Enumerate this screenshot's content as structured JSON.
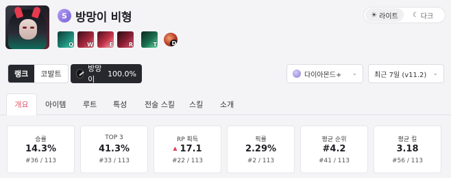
{
  "champion": {
    "name": "방망이 비형",
    "tier_badge": "S",
    "skills": [
      {
        "key": "Q",
        "icon": "skill-q-icon",
        "color": "#1f8c7a"
      },
      {
        "key": "W",
        "icon": "skill-w-icon",
        "color": "#a82840"
      },
      {
        "key": "E",
        "icon": "skill-e-icon",
        "color": "#c23246"
      },
      {
        "key": "R",
        "icon": "skill-r-icon",
        "color": "#8a1f34"
      },
      {
        "key": "T",
        "icon": "skill-t-icon",
        "color": "#1a6e4f"
      },
      {
        "key": "D",
        "icon": "skill-d-icon",
        "color": "#b83a24"
      }
    ]
  },
  "theme": {
    "light_label": "라이트",
    "dark_label": "다크",
    "light_icon": "sun-icon",
    "dark_icon": "moon-icon"
  },
  "modes": {
    "rank": "랭크",
    "cobalt": "코발트"
  },
  "selected_champion": {
    "name": "방망이",
    "rate": "100.0%"
  },
  "filters": {
    "tier": "다이아몬드+",
    "version": "최근 7일 (v11.2)"
  },
  "tabs": [
    "개요",
    "아이템",
    "루트",
    "특성",
    "전술 스킬",
    "스킬",
    "소개"
  ],
  "stats": [
    {
      "title": "승률",
      "value": "14.3%",
      "rank": "#36",
      "total": "113"
    },
    {
      "title": "TOP 3",
      "value": "41.3%",
      "rank": "#33",
      "total": "113"
    },
    {
      "title": "RP 획득",
      "value": "17.1",
      "rank": "#22",
      "total": "113",
      "trend": "up"
    },
    {
      "title": "픽률",
      "value": "2.29%",
      "rank": "#2",
      "total": "113"
    },
    {
      "title": "평균 순위",
      "value": "#4.2",
      "rank": "#41",
      "total": "113"
    },
    {
      "title": "평균 킬",
      "value": "3.18",
      "rank": "#56",
      "total": "113"
    }
  ],
  "colors": {
    "accent": "#e0556b",
    "dark": "#27272e",
    "trend_up": "#e0405a"
  }
}
